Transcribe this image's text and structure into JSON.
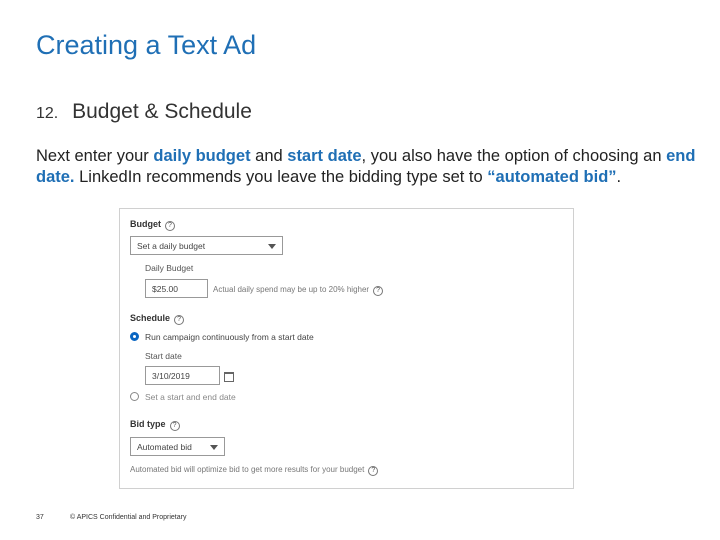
{
  "slide": {
    "title": "Creating a Text Ad",
    "step_number": "12.",
    "step_title": "Budget & Schedule",
    "body": {
      "t1": "Next enter your ",
      "h1": "daily budget",
      "t2": " and ",
      "h2": "start date",
      "t3": ", you also have the option of choosing an ",
      "h3": "end date.",
      "t4": " LinkedIn recommends you leave the bidding type set to ",
      "h4": "“automated bid”",
      "t5": "."
    },
    "footer_page": "37",
    "footer_copyright": "© APICS Confidential and Proprietary"
  },
  "form": {
    "budget_label": "Budget",
    "budget_select": "Set a daily budget",
    "daily_budget_label": "Daily Budget",
    "daily_budget_value": "$25.00",
    "daily_budget_hint": "Actual daily spend may be up to 20% higher",
    "schedule_label": "Schedule",
    "schedule_option_1": "Run campaign continuously from a start date",
    "start_date_label": "Start date",
    "start_date_value": "3/10/2019",
    "schedule_option_2": "Set a start and end date",
    "bid_type_label": "Bid type",
    "bid_type_select": "Automated bid",
    "bid_hint": "Automated bid will optimize bid to get more results for your budget",
    "help_glyph": "?"
  },
  "colors": {
    "title": "#1f6fb5",
    "highlight": "#1f6fb5",
    "radio_selected": "#0a66c2"
  }
}
